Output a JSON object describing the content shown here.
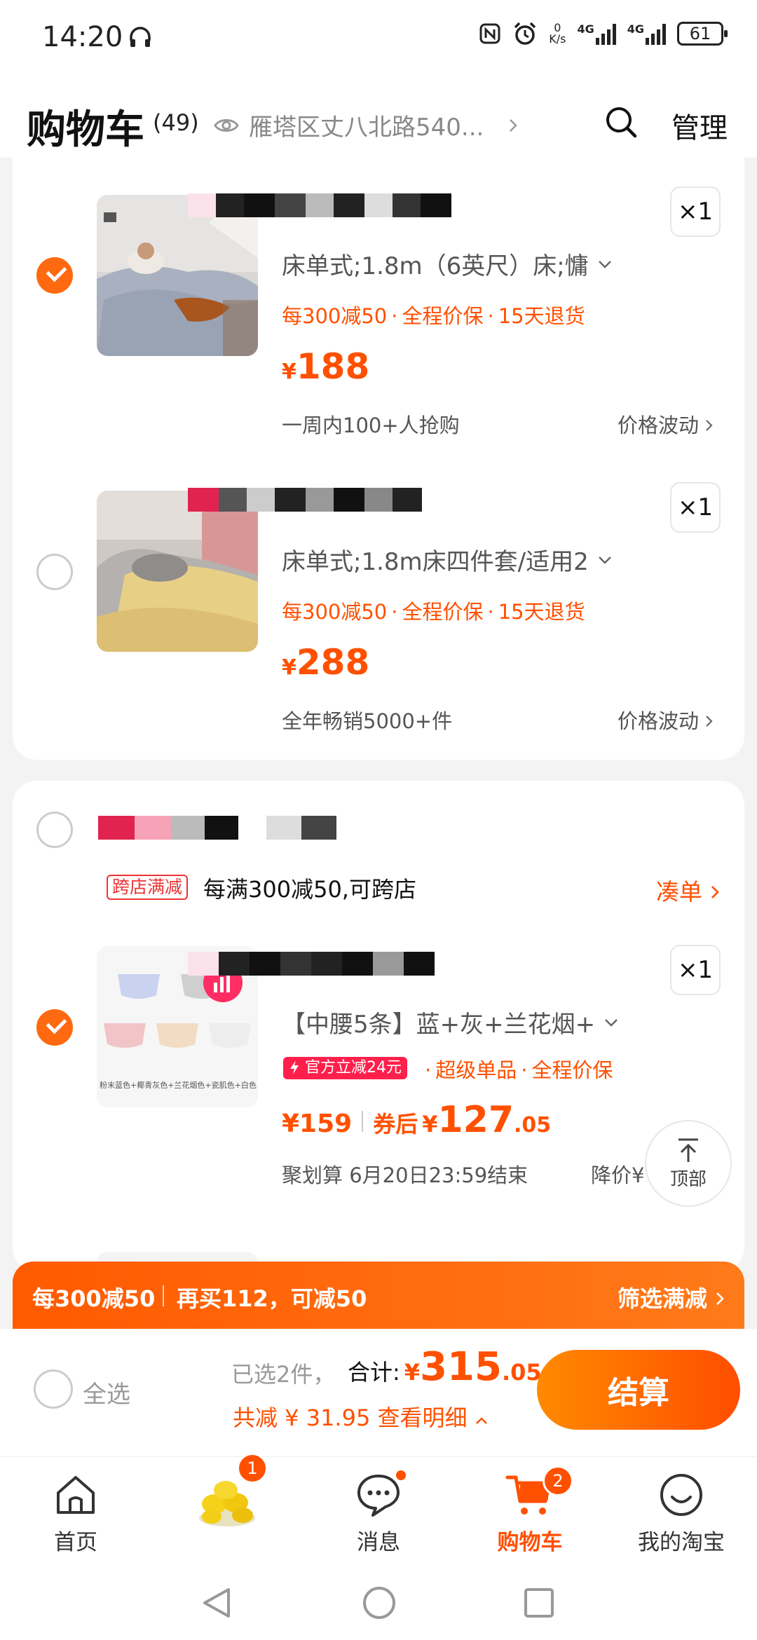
{
  "status_bar": {
    "time": "14:20",
    "net_speed_value": "0",
    "net_speed_unit": "K/s",
    "signal1": "4G",
    "signal2": "4G",
    "battery": "61"
  },
  "header": {
    "title": "购物车",
    "count": "(49)",
    "location": "雁塔区丈八北路540...",
    "manage_label": "管理"
  },
  "items": [
    {
      "spec": "床单式;1.8m（6英尺）床;慵",
      "promo": [
        "每300减50",
        "全程价保",
        "15天退货"
      ],
      "price_symbol": "¥",
      "price": "188",
      "quantity": "×1",
      "meta_left": "一周内100+人抢购",
      "meta_right": "价格波动",
      "checked": true
    },
    {
      "spec": "床单式;1.8m床四件套/适用2",
      "promo": [
        "每300减50",
        "全程价保",
        "15天退货"
      ],
      "price_symbol": "¥",
      "price": "288",
      "quantity": "×1",
      "meta_left": "全年畅销5000+件",
      "meta_right": "价格波动",
      "checked": false
    }
  ],
  "shop2": {
    "tag": "跨店满减",
    "desc": "每满300减50,可跨店",
    "more": "凑单",
    "item": {
      "spec": "【中腰5条】蓝+灰+兰花烟+",
      "badge": "官方立减24元",
      "promo": [
        "超级单品",
        "全程价保"
      ],
      "price": "¥159",
      "coupon_label": "券后",
      "coupon_symbol": "¥",
      "coupon_int": "127",
      "coupon_dec": ".05",
      "quantity": "×1",
      "meta_left": "聚划算 6月20日23:59结束",
      "meta_right": "降价¥",
      "thumb_caption": "粉末蓝色+椰青灰色+兰花烟色+瓷肌色+白色",
      "checked": true
    }
  },
  "back_to_top": "顶部",
  "promo_strip": {
    "left": "每300减50",
    "middle": "再买112，可减50",
    "right": "筛选满减"
  },
  "checkout": {
    "select_all": "全选",
    "selected": "已选2件，",
    "total_label": "合计:",
    "total_symbol": "¥",
    "total_int": "315",
    "total_dec": ".05",
    "discount": "共减 ¥ 31.95  查看明细",
    "button": "结算"
  },
  "tabs": [
    {
      "label": "首页",
      "icon": "home-icon"
    },
    {
      "label": "",
      "icon": "lemon-promo-icon",
      "badge": "1"
    },
    {
      "label": "消息",
      "icon": "message-icon"
    },
    {
      "label": "购物车",
      "icon": "cart-icon",
      "badge": "2",
      "active": true
    },
    {
      "label": "我的淘宝",
      "icon": "profile-icon"
    }
  ],
  "colors": {
    "accent": "#ff5000",
    "accent_gradient_start": "#ff8a00",
    "accent_gradient_end": "#ff4d00",
    "badge_red": "#ff1f4b"
  }
}
